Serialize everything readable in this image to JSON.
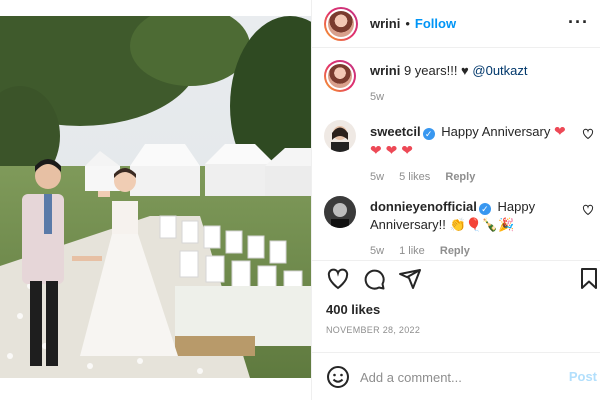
{
  "post": {
    "username": "wrini",
    "follow_label": "Follow",
    "dot": "•",
    "more_label": "···"
  },
  "caption": {
    "username": "wrini",
    "text": "9 years!!! ♥",
    "mention": "@0utkazt",
    "time": "5w"
  },
  "comments": [
    {
      "username": "sweetcil",
      "verified": true,
      "text_before": "Happy Anniversary",
      "emoji": "❤ ❤ ❤ ❤",
      "time": "5w",
      "likes": "5 likes",
      "reply": "Reply"
    },
    {
      "username": "donnieyenofficial",
      "verified": true,
      "text": "Happy Anniversary!!",
      "emoji": "👏🎈🍾🎉",
      "time": "5w",
      "likes": "1 like",
      "reply": "Reply"
    }
  ],
  "verified_mark": "✓",
  "stats": {
    "likes": "400 likes",
    "date": "NOVEMBER 28, 2022"
  },
  "composer": {
    "placeholder": "Add a comment...",
    "post_label": "Post"
  },
  "icons": [
    "heart-icon",
    "comment-icon",
    "share-icon",
    "bookmark-icon",
    "emoji-icon"
  ],
  "colors": {
    "accent": "#0095f6",
    "heart": "#ed4956",
    "muted": "#8e8e8e"
  }
}
